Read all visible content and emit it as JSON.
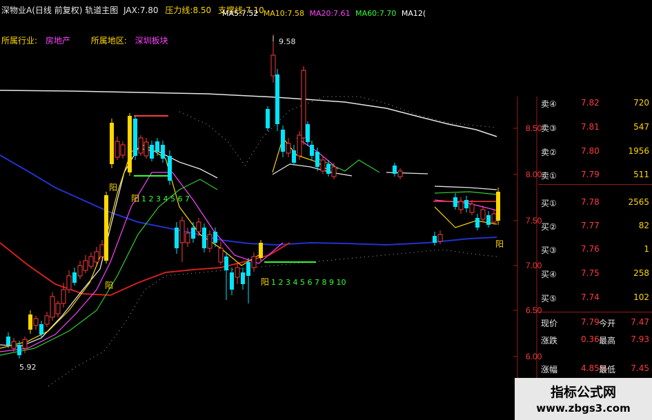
{
  "header": {
    "title": "深物业A(日线 前复权) 轨道主图",
    "jax_label": "JAX:",
    "jax_value": "7.80",
    "pressure_label": "压力线:",
    "pressure_value": "8.50",
    "support_label": "支撑线:",
    "support_value": "7.10",
    "ma": [
      {
        "label": "MA5:",
        "value": "7.52",
        "color": "#ffffff"
      },
      {
        "label": "MA10:",
        "value": "7.58",
        "color": "#ffd700"
      },
      {
        "label": "MA20:",
        "value": "7.61",
        "color": "#ff44ff"
      },
      {
        "label": "MA60:",
        "value": "7.70",
        "color": "#33ff33"
      },
      {
        "label": "MA1",
        "value": "2(",
        "color": "#ffffff"
      }
    ],
    "industry_label": "所属行业:",
    "industry_value": "房地产",
    "region_label": "所属地区:",
    "region_value": "深圳板块"
  },
  "annotations": {
    "high_label": "9.58",
    "low_label": "5.92",
    "yang_labels": [
      "阳",
      "阳",
      "阳",
      "阳"
    ],
    "count_1": "1 2 3 4 5 6 7",
    "count_2": "1 2 3 4 5 6 7 8 9 10"
  },
  "axis": {
    "ticks": [
      "8.50",
      "8.00",
      "7.50",
      "7.00",
      "6.50",
      "6.00"
    ]
  },
  "order_book": {
    "sell": [
      {
        "label": "卖④",
        "price": "7.82",
        "vol": "720"
      },
      {
        "label": "卖③",
        "price": "7.81",
        "vol": "547"
      },
      {
        "label": "卖②",
        "price": "7.80",
        "vol": "1956"
      },
      {
        "label": "卖①",
        "price": "7.79",
        "vol": "511"
      }
    ],
    "buy": [
      {
        "label": "买①",
        "price": "7.78",
        "vol": "2565"
      },
      {
        "label": "买②",
        "price": "7.77",
        "vol": "82"
      },
      {
        "label": "买③",
        "price": "7.76",
        "vol": "1"
      },
      {
        "label": "买④",
        "price": "7.75",
        "vol": "258"
      },
      {
        "label": "买⑤",
        "price": "7.74",
        "vol": "102"
      }
    ]
  },
  "quote": [
    {
      "label": "现价",
      "value": "7.79",
      "label2": "今开",
      "value2": "7.47"
    },
    {
      "label": "涨跌",
      "value": "0.36",
      "label2": "最高",
      "value2": "7.93"
    },
    {
      "label": "涨幅",
      "value": "4.85%",
      "label2": "最低",
      "value2": "7.45"
    }
  ],
  "watermark": {
    "line1": "指标公式网",
    "line2": "www.zbgs3.com"
  },
  "colors": {
    "axis_red": "#9b1b1b",
    "up": "#ff3b3b",
    "down": "#00e5ff",
    "yellow": "#ffd700",
    "blue_line": "#2233cc",
    "red_line": "#d42020",
    "white_line": "#e8e8e8"
  }
}
